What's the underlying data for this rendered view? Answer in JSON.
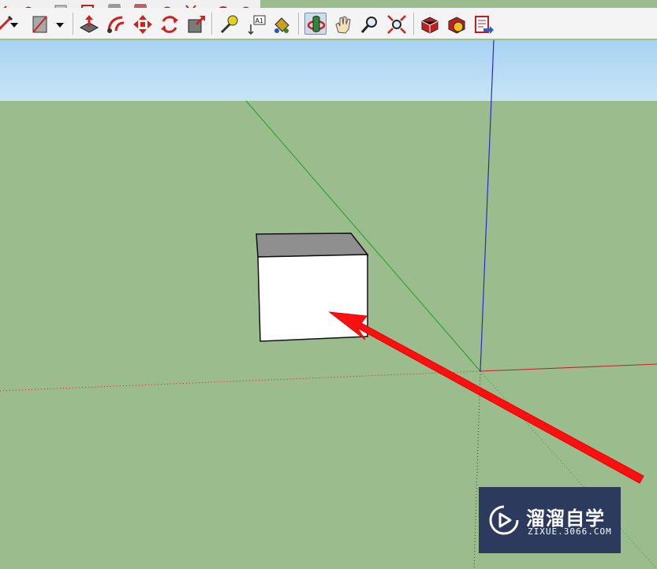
{
  "toolbar": {
    "buttons": [
      {
        "name": "pencil-icon",
        "active": false
      },
      {
        "name": "dropdown-arrow-icon",
        "active": false
      },
      {
        "name": "rectangle-icon",
        "active": false
      },
      {
        "name": "dropdown-arrow-icon",
        "active": false
      },
      {
        "name": "push-pull-icon",
        "active": false
      },
      {
        "name": "follow-me-icon",
        "active": false
      },
      {
        "name": "move-icon",
        "active": false
      },
      {
        "name": "rotate-icon",
        "active": false
      },
      {
        "name": "scale-icon",
        "active": false
      },
      {
        "name": "tape-measure-icon",
        "active": false
      },
      {
        "name": "text-icon",
        "active": false
      },
      {
        "name": "paint-bucket-icon",
        "active": false
      },
      {
        "name": "orbit-icon",
        "active": true
      },
      {
        "name": "pan-icon",
        "active": false
      },
      {
        "name": "zoom-icon",
        "active": false
      },
      {
        "name": "zoom-extents-icon",
        "active": false
      },
      {
        "name": "3d-warehouse-icon",
        "active": false
      },
      {
        "name": "extension-warehouse-icon",
        "active": false
      },
      {
        "name": "send-to-layout-icon",
        "active": false
      }
    ],
    "text_tool_label": "A1"
  },
  "viewport": {
    "sky_color": "#c8e4f6",
    "ground_color": "#9bbd8e",
    "axis_colors": {
      "red": "#c42020",
      "green": "#1fa01f",
      "blue": "#2a2ac8"
    },
    "box_top_color": "#8f8f8f",
    "box_front_color": "#ffffff"
  },
  "annotation": {
    "arrow_color": "#ff1010"
  },
  "watermark": {
    "title": "溜溜自学",
    "url": "ZIXUE.3066.COM"
  }
}
